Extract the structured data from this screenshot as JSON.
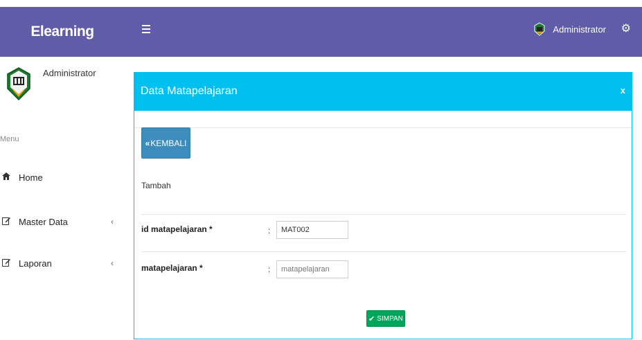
{
  "header": {
    "brand": "Elearning",
    "user_name": "Administrator"
  },
  "sidebar": {
    "user_name": "Administrator",
    "menu_header": "Menu",
    "items": [
      {
        "label": "Home",
        "icon": "home-icon"
      },
      {
        "label": "Master Data",
        "icon": "edit-icon",
        "chevron": "‹"
      },
      {
        "label": "Laporan",
        "icon": "edit-icon",
        "chevron": "‹"
      }
    ]
  },
  "panel": {
    "title": "Data Matapelajaran",
    "close": "x",
    "back_label": "KEMBALI",
    "subtitle": "Tambah",
    "fields": [
      {
        "label": "id matapelajaran *",
        "value": "MAT002",
        "placeholder": ""
      },
      {
        "label": "matapelajaran *",
        "value": "",
        "placeholder": "matapelajaran"
      }
    ],
    "colon": ":",
    "save_label": "SIMPAN"
  },
  "colors": {
    "header_bg": "#605ca8",
    "box_header_bg": "#00c0ef",
    "back_button_bg": "#3c8dbc",
    "save_button_bg": "#00a65a"
  }
}
